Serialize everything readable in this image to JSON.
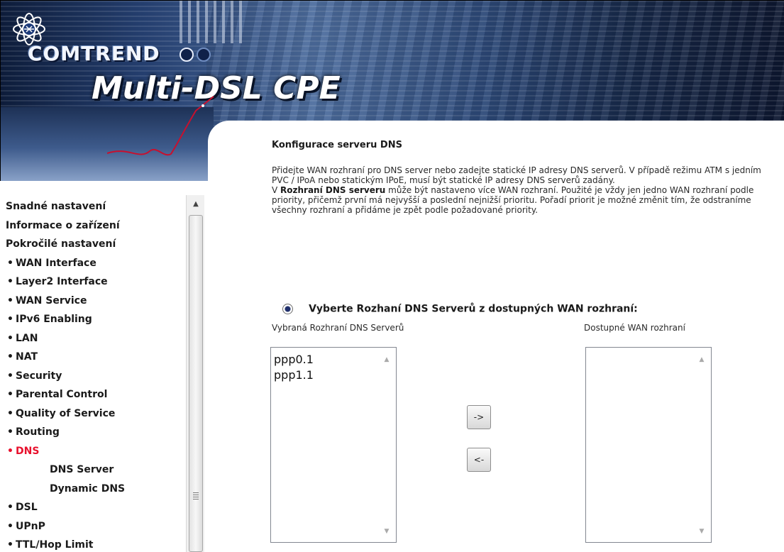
{
  "header": {
    "brand": "COMTREND",
    "product": "Multi-DSL CPE"
  },
  "sidebar": {
    "items": [
      {
        "label": "Snadné nastavení",
        "level": 0,
        "active": false
      },
      {
        "label": "Informace o zařízení",
        "level": 0,
        "active": false
      },
      {
        "label": "Pokročilé nastavení",
        "level": 0,
        "active": false
      },
      {
        "label": "WAN Interface",
        "level": 1,
        "active": false
      },
      {
        "label": "Layer2 Interface",
        "level": 1,
        "active": false
      },
      {
        "label": "WAN Service",
        "level": 1,
        "active": false
      },
      {
        "label": "IPv6 Enabling",
        "level": 1,
        "active": false
      },
      {
        "label": "LAN",
        "level": 1,
        "active": false
      },
      {
        "label": "NAT",
        "level": 1,
        "active": false
      },
      {
        "label": "Security",
        "level": 1,
        "active": false
      },
      {
        "label": "Parental Control",
        "level": 1,
        "active": false
      },
      {
        "label": "Quality of Service",
        "level": 1,
        "active": false
      },
      {
        "label": "Routing",
        "level": 1,
        "active": false
      },
      {
        "label": "DNS",
        "level": 1,
        "active": true
      },
      {
        "label": "DNS Server",
        "level": 2,
        "active": false
      },
      {
        "label": "Dynamic DNS",
        "level": 2,
        "active": false
      },
      {
        "label": "DSL",
        "level": 1,
        "active": false
      },
      {
        "label": "UPnP",
        "level": 1,
        "active": false
      },
      {
        "label": "TTL/Hop Limit",
        "level": 1,
        "active": false
      }
    ]
  },
  "main": {
    "title": "Konfigurace serveru DNS",
    "paragraph1": "Přidejte WAN rozhraní pro DNS server nebo zadejte statické IP adresy DNS serverů. V případě režimu ATM s jedním PVC / IPoA nebo statickým IPoE, musí být statické IP adresy DNS serverů zadány.",
    "paragraph2_prefix": "V ",
    "paragraph2_bold": "Rozhraní DNS serveru",
    "paragraph2_rest": " může být nastaveno více WAN rozhraní. Použité je vždy jen jedno WAN rozhraní podle priority, přičemž první má nejvyšší a poslední nejnižší prioritu. Pořadí priorit je možné změnit tím, že odstraníme všechny rozhraní a přidáme je zpět podle požadované priority.",
    "radio_label": "Vyberte Rozhaní DNS Serverů z dostupných WAN rozhraní:",
    "radio_checked": true,
    "selected_label": "Vybraná Rozhraní DNS Serverů",
    "available_label": "Dostupné WAN rozhraní",
    "selected_interfaces": [
      "ppp0.1",
      "ppp1.1"
    ],
    "available_interfaces": [],
    "add_button": "->",
    "remove_button": "<-"
  },
  "colors": {
    "active_menu": "#e8112d",
    "banner_dark": "#0d1c3a",
    "banner_mid": "#4d6d9e"
  }
}
